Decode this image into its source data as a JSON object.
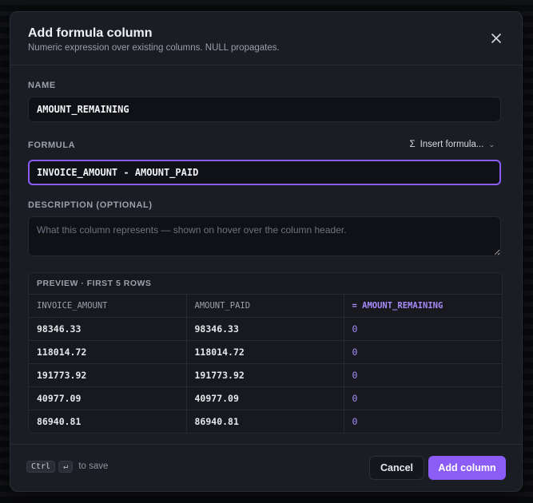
{
  "dialog": {
    "title": "Add formula column",
    "subtitle": "Numeric expression over existing columns. NULL propagates."
  },
  "name_field": {
    "label": "NAME",
    "value": "AMOUNT_REMAINING"
  },
  "formula_field": {
    "label": "FORMULA",
    "value": "INVOICE_AMOUNT - AMOUNT_PAID",
    "insert_label": "Insert formula...",
    "insert_icon": "sigma-icon"
  },
  "description_field": {
    "label": "DESCRIPTION (OPTIONAL)",
    "placeholder": "What this column represents — shown on hover over the column header."
  },
  "preview": {
    "title": "PREVIEW · FIRST 5 ROWS",
    "columns": [
      "INVOICE_AMOUNT",
      "AMOUNT_PAID",
      "= AMOUNT_REMAINING"
    ],
    "rows": [
      [
        "98346.33",
        "98346.33",
        "0"
      ],
      [
        "118014.72",
        "118014.72",
        "0"
      ],
      [
        "191773.92",
        "191773.92",
        "0"
      ],
      [
        "40977.09",
        "40977.09",
        "0"
      ],
      [
        "86940.81",
        "86940.81",
        "0"
      ]
    ]
  },
  "footer": {
    "key1": "Ctrl",
    "key2": "↵",
    "hint": "to save",
    "cancel_label": "Cancel",
    "submit_label": "Add column"
  },
  "colors": {
    "accent": "#8b5cf6",
    "result_text": "#a78bfa",
    "modal_bg": "#1b1d24"
  }
}
